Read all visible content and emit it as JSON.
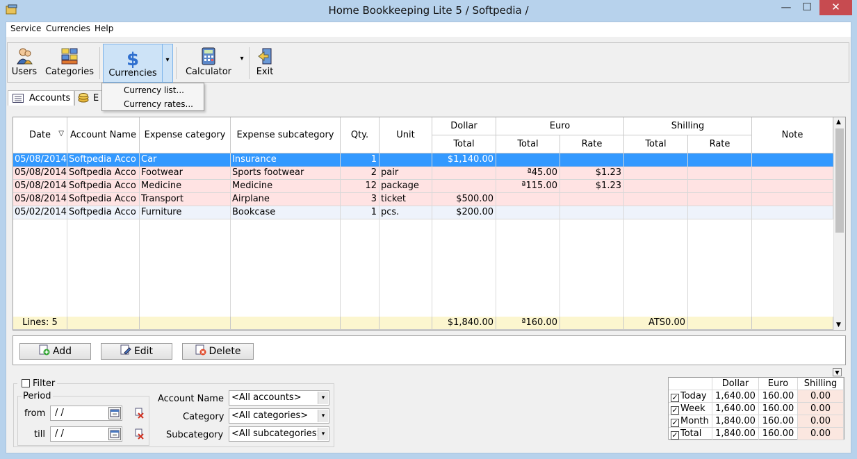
{
  "window": {
    "title": "Home Bookkeeping Lite 5  / Softpedia /",
    "minimize": "—",
    "maximize": "☐",
    "close": "✕"
  },
  "menu": [
    "Service",
    "Currencies",
    "Help"
  ],
  "toolbar": {
    "users": "Users",
    "categories": "Categories",
    "currencies": "Currencies",
    "calculator": "Calculator",
    "exit": "Exit",
    "dropdown_arrow": "▾"
  },
  "dropdown": [
    "Currency list...",
    "Currency rates..."
  ],
  "tabs": [
    "Accounts",
    "E"
  ],
  "grid": {
    "headers": {
      "date": "Date",
      "account": "Account Name",
      "category": "Expense category",
      "subcategory": "Expense subcategory",
      "qty": "Qty.",
      "unit": "Unit",
      "dollar": "Dollar",
      "euro": "Euro",
      "shilling": "Shilling",
      "note": "Note",
      "total": "Total",
      "rate": "Rate",
      "sort_indicator": "▽"
    },
    "rows": [
      [
        "05/08/2014",
        "Softpedia Acco",
        "Car",
        "Insurance",
        "1",
        "",
        "$1,140.00",
        "",
        "",
        "",
        "",
        ""
      ],
      [
        "05/08/2014",
        "Softpedia Acco",
        "Footwear",
        "Sports footwear",
        "2",
        "pair",
        "",
        "ª45.00",
        "$1.23",
        "",
        "",
        ""
      ],
      [
        "05/08/2014",
        "Softpedia Acco",
        "Medicine",
        "Medicine",
        "12",
        "package",
        "",
        "ª115.00",
        "$1.23",
        "",
        "",
        ""
      ],
      [
        "05/08/2014",
        "Softpedia Acco",
        "Transport",
        "Airplane",
        "3",
        "ticket",
        "$500.00",
        "",
        "",
        "",
        "",
        ""
      ],
      [
        "05/02/2014",
        "Softpedia Acco",
        "Furniture",
        "Bookcase",
        "1",
        "pcs.",
        "$200.00",
        "",
        "",
        "",
        "",
        ""
      ]
    ],
    "footer": {
      "lines": "Lines: 5",
      "dollar_total": "$1,840.00",
      "euro_total": "ª160.00",
      "shilling_total": "ATS0.00"
    }
  },
  "actions": {
    "add": "Add",
    "edit": "Edit",
    "delete": "Delete"
  },
  "filter": {
    "label": "Filter",
    "period": "Period",
    "from": "from",
    "till": "till",
    "from_value": " /  /",
    "till_value": " /  /",
    "account_label": "Account Name",
    "account_value": "<All accounts>",
    "category_label": "Category",
    "category_value": "<All categories>",
    "subcategory_label": "Subcategory",
    "subcategory_value": "<All subcategories>"
  },
  "summary": {
    "headers": [
      "Dollar",
      "Euro",
      "Shilling"
    ],
    "rows": [
      {
        "label": "Today",
        "values": [
          "1,640.00",
          "160.00",
          "0.00"
        ]
      },
      {
        "label": "Week",
        "values": [
          "1,640.00",
          "160.00",
          "0.00"
        ]
      },
      {
        "label": "Month",
        "values": [
          "1,840.00",
          "160.00",
          "0.00"
        ]
      },
      {
        "label": "Total",
        "values": [
          "1,840.00",
          "160.00",
          "0.00"
        ]
      }
    ],
    "check": "✓"
  },
  "colors": {
    "selected": "#3399ff",
    "pink": "#ffe3e3",
    "light": "#eef3fb",
    "footer": "#fcf6cf",
    "sum_pink": "#fbe7e0"
  }
}
